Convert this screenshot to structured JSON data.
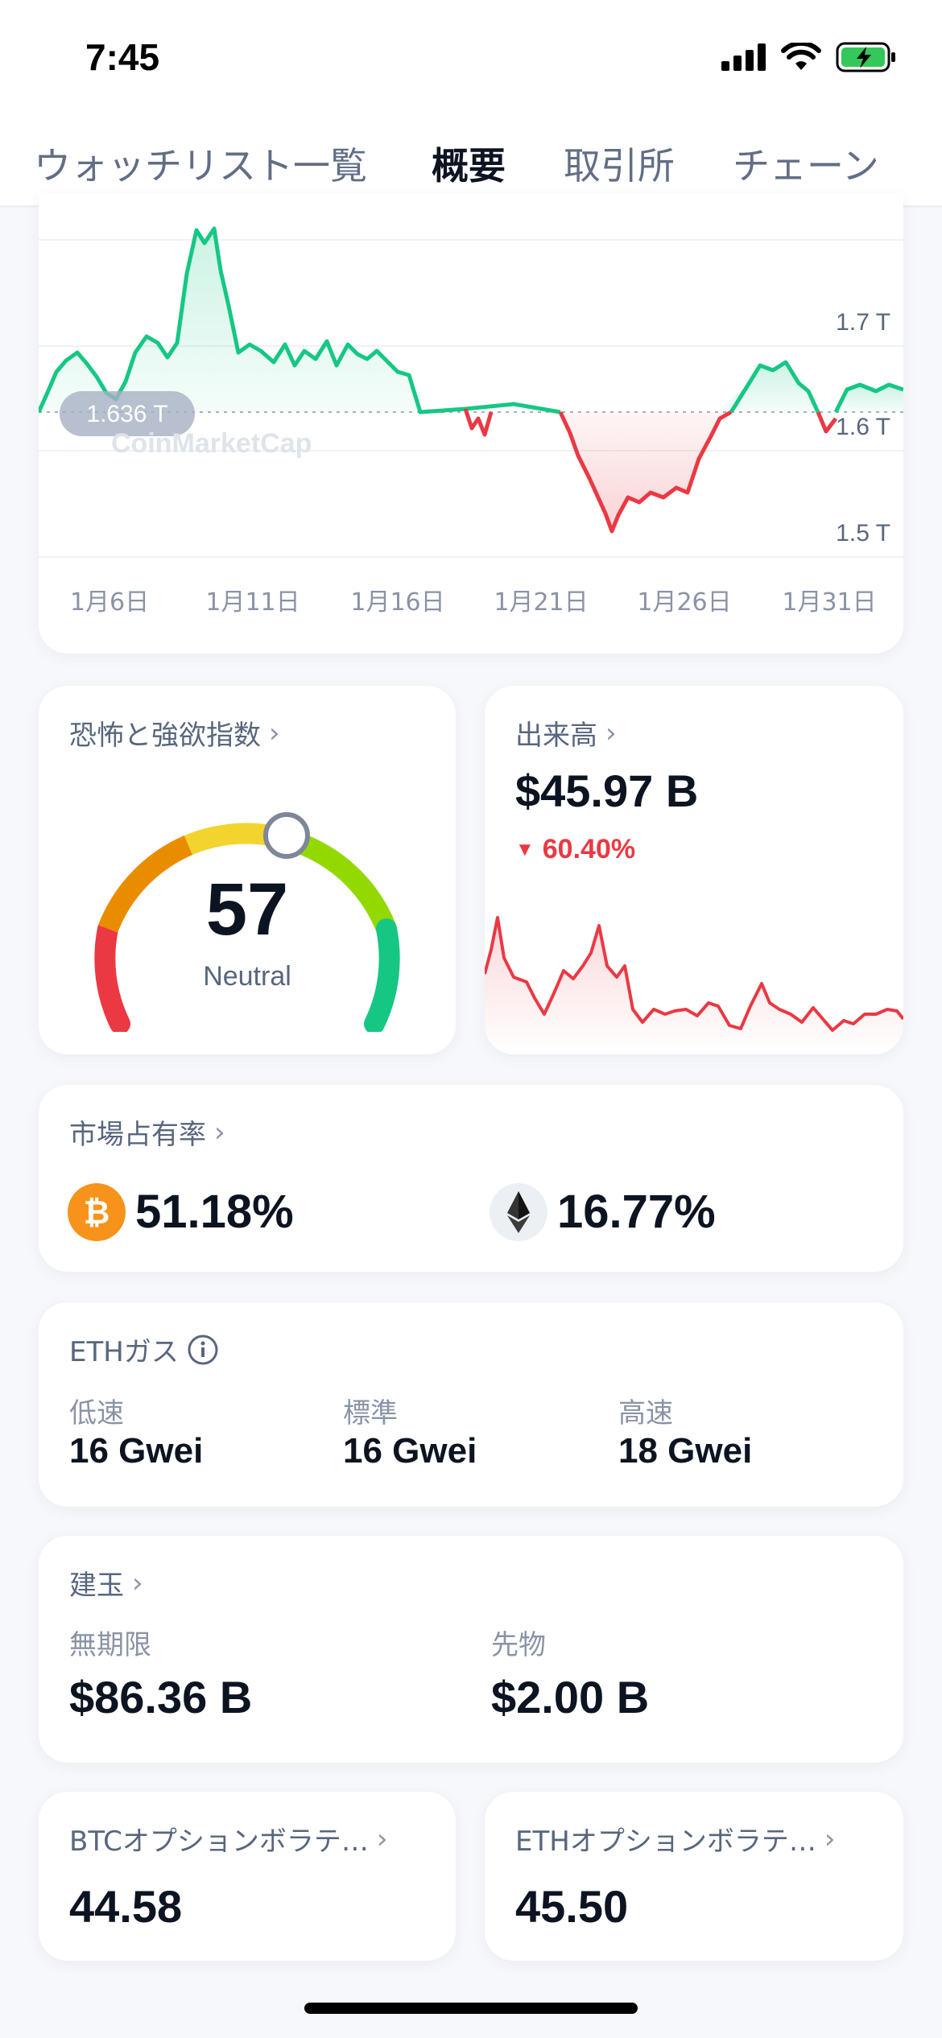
{
  "status": {
    "time": "7:45"
  },
  "tabs": [
    {
      "label": "ウォッチリスト一覧",
      "active": false
    },
    {
      "label": "概要",
      "active": true
    },
    {
      "label": "取引所",
      "active": false
    },
    {
      "label": "チェーン",
      "active": false
    }
  ],
  "marketcap_chart": {
    "baseline_label": "1.636 T",
    "y_ticks": [
      "1.7 T",
      "1.6 T",
      "1.5 T"
    ],
    "x_ticks": [
      "1月6日",
      "1月11日",
      "1月16日",
      "1月21日",
      "1月26日",
      "1月31日"
    ],
    "watermark": "CoinMarketCap",
    "colors": {
      "up": "#16c784",
      "down": "#ea3943"
    }
  },
  "fear_greed": {
    "title": "恐怖と強欲指数",
    "value": "57",
    "label": "Neutral"
  },
  "volume": {
    "title": "出来高",
    "value": "$45.97 B",
    "change": "60.40%",
    "change_color": "#ea3943"
  },
  "dominance": {
    "title": "市場占有率",
    "btc": "51.18%",
    "eth": "16.77%",
    "btc_color": "#f7931a"
  },
  "eth_gas": {
    "title": "ETHガス",
    "items": [
      {
        "label": "低速",
        "value": "16 Gwei"
      },
      {
        "label": "標準",
        "value": "16 Gwei"
      },
      {
        "label": "高速",
        "value": "18 Gwei"
      }
    ]
  },
  "open_interest": {
    "title": "建玉",
    "perpetual_label": "無期限",
    "perpetual_value": "$86.36 B",
    "futures_label": "先物",
    "futures_value": "$2.00 B"
  },
  "btc_vol": {
    "title": "BTCオプションボラテ…",
    "value": "44.58"
  },
  "eth_vol": {
    "title": "ETHオプションボラテ…",
    "value": "45.50"
  }
}
